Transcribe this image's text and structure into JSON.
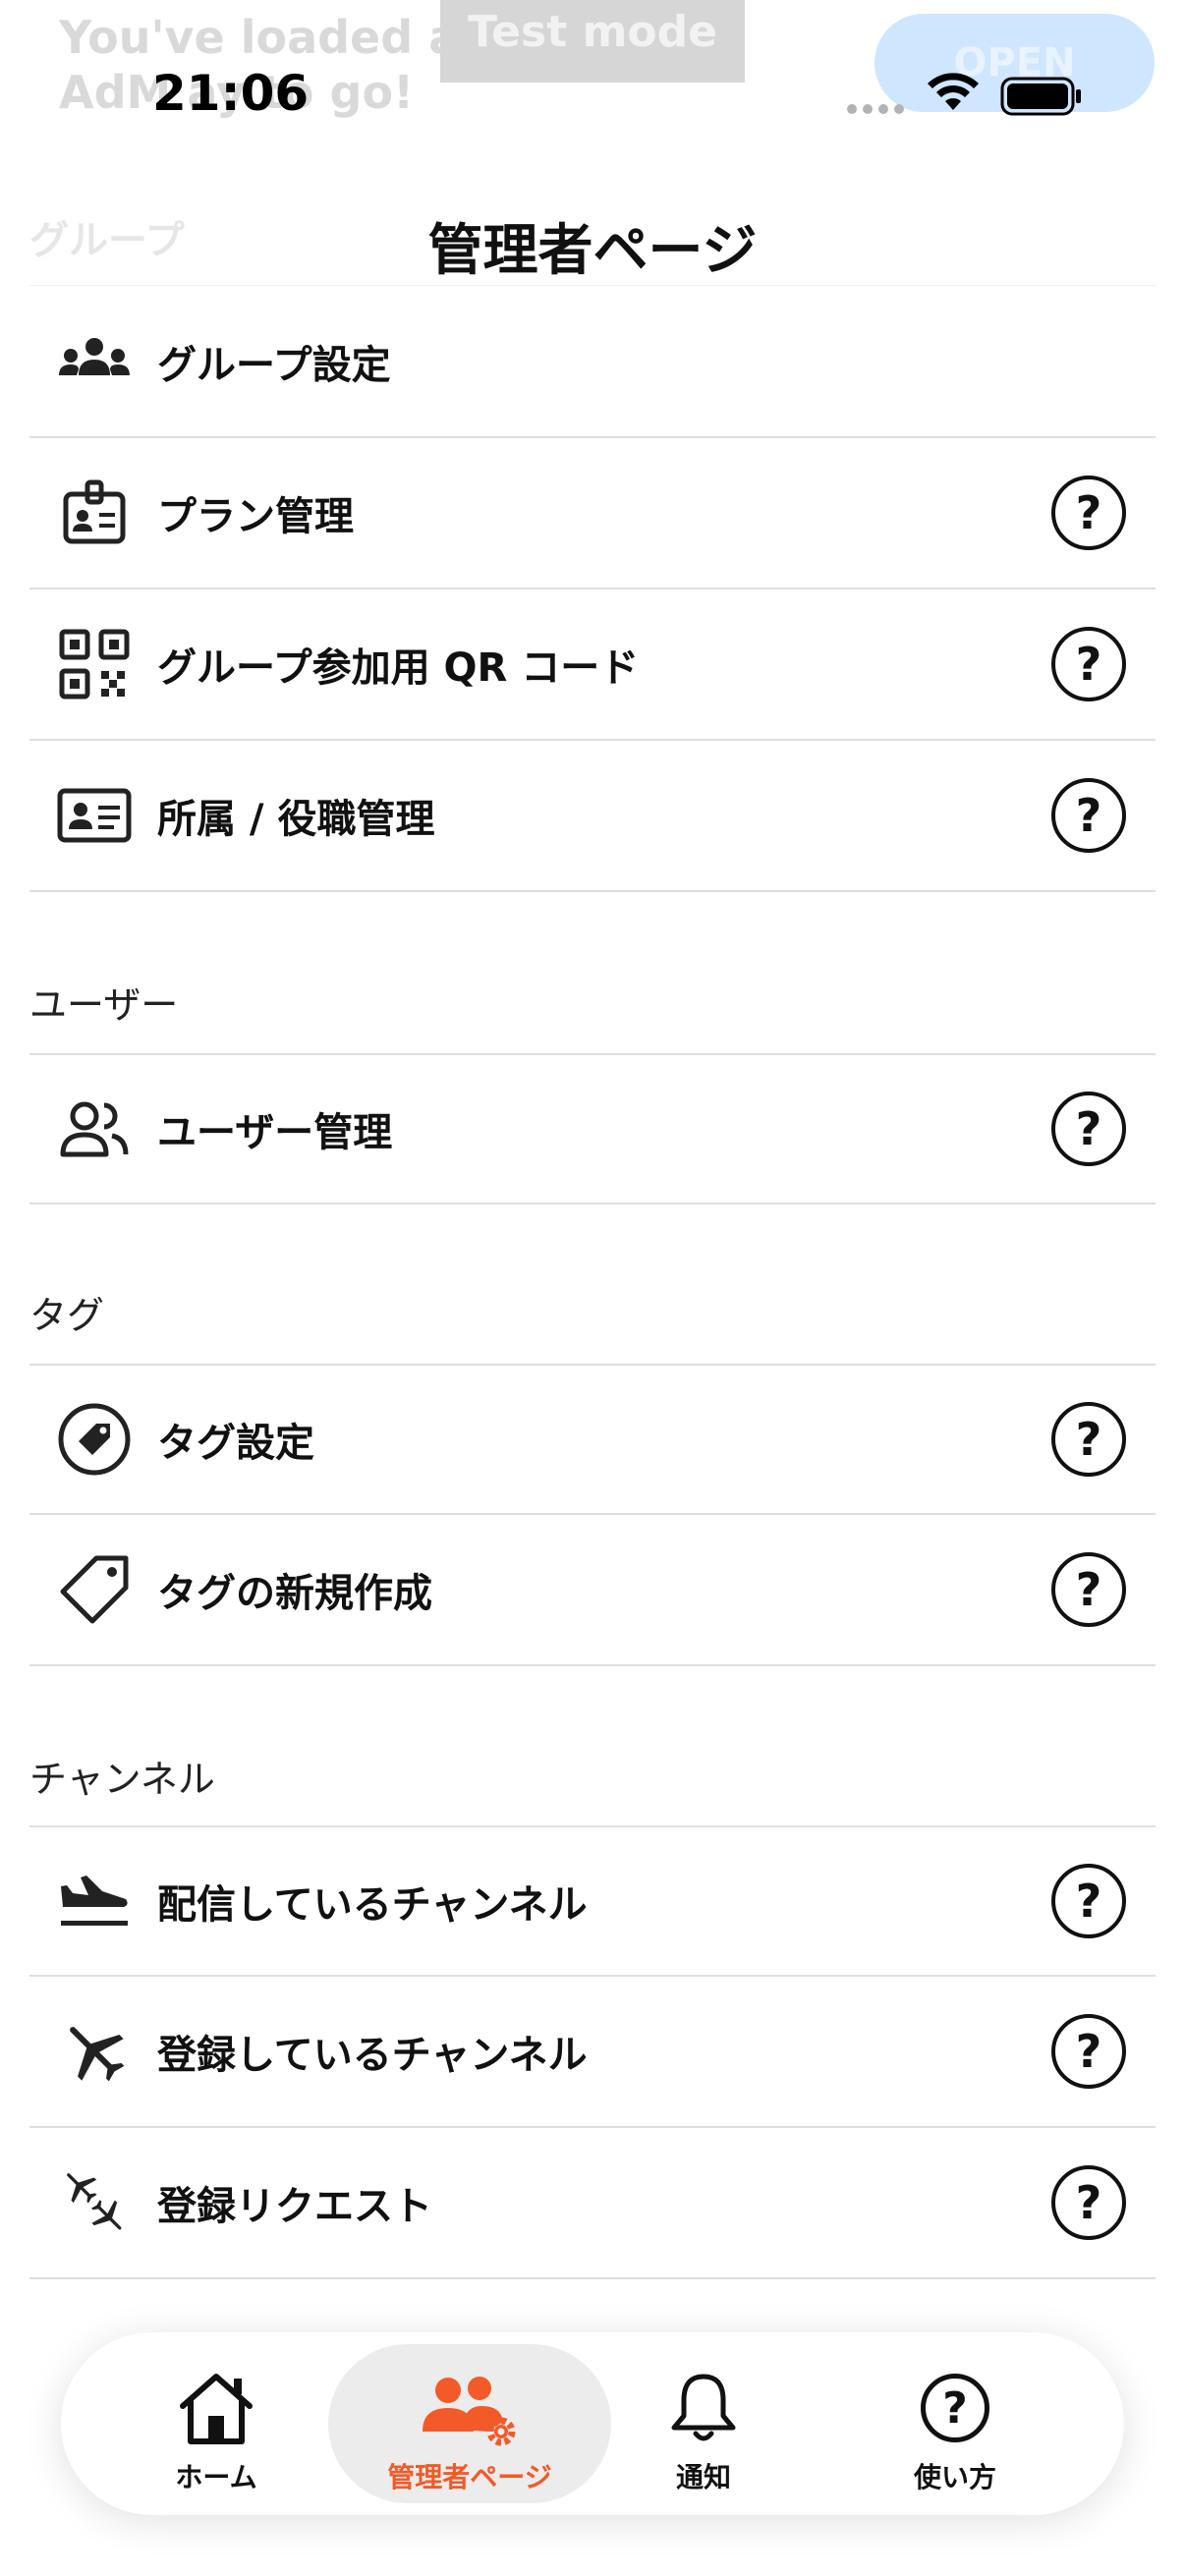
{
  "ad": {
    "line1": "You've loaded a",
    "line2": "AdM      ay to go!",
    "test_mode": "Test mode",
    "open_label": "OPEN"
  },
  "status_bar": {
    "time": "21:06"
  },
  "header": {
    "title": "管理者ページ",
    "ghost_section": "グループ"
  },
  "sections": {
    "user": "ユーザー",
    "tag": "タグ",
    "channel": "チャンネル"
  },
  "items": {
    "group_settings": "グループ設定",
    "plan_management": "プラン管理",
    "group_qr": "グループ参加用 QR コード",
    "affiliation": "所属 / 役職管理",
    "user_management": "ユーザー管理",
    "tag_settings": "タグ設定",
    "tag_new": "タグの新規作成",
    "channel_publishing": "配信しているチャンネル",
    "channel_subscribed": "登録しているチャンネル",
    "channel_requests": "登録リクエスト"
  },
  "help_glyph": "?",
  "tabs": {
    "home": "ホーム",
    "admin": "管理者ページ",
    "notify": "通知",
    "howto": "使い方"
  },
  "colors": {
    "accent": "#f25a28",
    "text": "#111111",
    "divider": "#dedede"
  }
}
